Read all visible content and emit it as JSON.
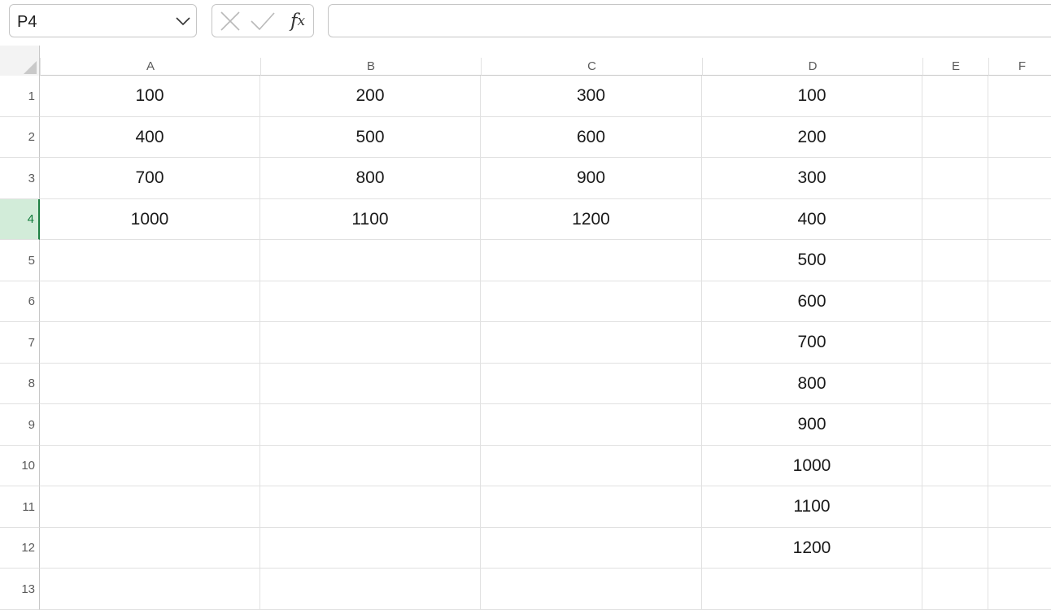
{
  "formula_bar": {
    "name_box": "P4",
    "formula": "",
    "fx_label": "f",
    "fx_sub": "x",
    "icons": [
      "chevron-down-icon",
      "cancel-icon",
      "enter-check-icon",
      "function-icon"
    ]
  },
  "columns": [
    "A",
    "B",
    "C",
    "D",
    "E",
    "F"
  ],
  "rows": [
    "1",
    "2",
    "3",
    "4",
    "5",
    "6",
    "7",
    "8",
    "9",
    "10",
    "11",
    "12",
    "13"
  ],
  "active_row": "4",
  "colors": {
    "active_header_bg": "#d2ecd9",
    "active_header_text": "#117a3a",
    "gridline": "#e1e1e1"
  },
  "cells": [
    [
      "100",
      "200",
      "300",
      "100",
      "",
      ""
    ],
    [
      "400",
      "500",
      "600",
      "200",
      "",
      ""
    ],
    [
      "700",
      "800",
      "900",
      "300",
      "",
      ""
    ],
    [
      "1000",
      "1100",
      "1200",
      "400",
      "",
      ""
    ],
    [
      "",
      "",
      "",
      "500",
      "",
      ""
    ],
    [
      "",
      "",
      "",
      "600",
      "",
      ""
    ],
    [
      "",
      "",
      "",
      "700",
      "",
      ""
    ],
    [
      "",
      "",
      "",
      "800",
      "",
      ""
    ],
    [
      "",
      "",
      "",
      "900",
      "",
      ""
    ],
    [
      "",
      "",
      "",
      "1000",
      "",
      ""
    ],
    [
      "",
      "",
      "",
      "1100",
      "",
      ""
    ],
    [
      "",
      "",
      "",
      "1200",
      "",
      ""
    ],
    [
      "",
      "",
      "",
      "",
      "",
      ""
    ]
  ]
}
